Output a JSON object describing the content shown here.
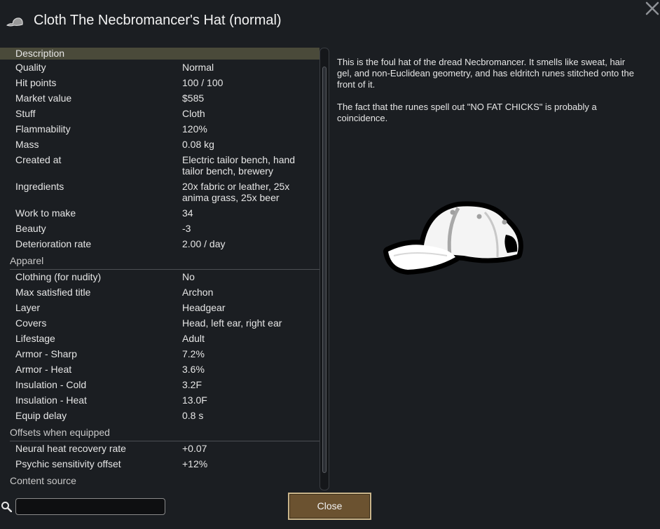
{
  "window": {
    "title": "Cloth The Necbromancer's Hat (normal)",
    "title_icon": "hat-icon",
    "close_icon": "close-icon"
  },
  "stats": {
    "description_header": "Description",
    "general": [
      {
        "label": "Quality",
        "value": "Normal"
      },
      {
        "label": "Hit points",
        "value": "100 / 100"
      },
      {
        "label": "Market value",
        "value": "$585"
      },
      {
        "label": "Stuff",
        "value": "Cloth"
      },
      {
        "label": "Flammability",
        "value": "120%"
      },
      {
        "label": "Mass",
        "value": "0.08 kg"
      },
      {
        "label": "Created at",
        "value": "Electric tailor bench, hand tailor bench, brewery"
      },
      {
        "label": "Ingredients",
        "value": "20x fabric or leather, 25x anima grass, 25x beer"
      },
      {
        "label": "Work to make",
        "value": "34"
      },
      {
        "label": "Beauty",
        "value": "-3"
      },
      {
        "label": "Deterioration rate",
        "value": "2.00 / day"
      }
    ],
    "apparel_header": "Apparel",
    "apparel": [
      {
        "label": "Clothing (for nudity)",
        "value": "No"
      },
      {
        "label": "Max satisfied title",
        "value": "Archon"
      },
      {
        "label": "Layer",
        "value": "Headgear"
      },
      {
        "label": "Covers",
        "value": "Head, left ear, right ear"
      },
      {
        "label": "Lifestage",
        "value": "Adult"
      },
      {
        "label": "Armor - Sharp",
        "value": "7.2%"
      },
      {
        "label": "Armor - Heat",
        "value": "3.6%"
      },
      {
        "label": "Insulation - Cold",
        "value": "3.2F"
      },
      {
        "label": "Insulation - Heat",
        "value": "13.0F"
      },
      {
        "label": "Equip delay",
        "value": "0.8 s"
      }
    ],
    "offsets_header": "Offsets when equipped",
    "offsets": [
      {
        "label": "Neural heat recovery rate",
        "value": "+0.07"
      },
      {
        "label": "Psychic sensitivity offset",
        "value": "+12%"
      }
    ],
    "content_header": "Content source"
  },
  "description": {
    "paragraphs": [
      "This is the foul hat of the dread Necbromancer. It smells like sweat, hair gel, and non-Euclidean geometry, and has eldritch runes stitched onto the front of it.",
      "The fact that the runes spell out \"NO FAT CHICKS\" is probably a coincidence."
    ],
    "image_icon": "baseball-cap-icon"
  },
  "footer": {
    "search_icon": "search-icon",
    "search_value": "",
    "close_label": "Close"
  },
  "colors": {
    "background": "#1b1e22",
    "description_highlight": "#4a4a3a",
    "button_fill": "#6b5230",
    "button_border": "#c9b48a"
  }
}
